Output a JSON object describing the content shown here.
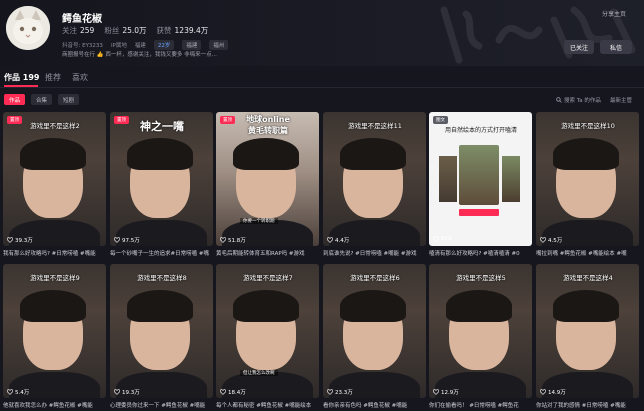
{
  "profile": {
    "name": "鳄鱼花椒",
    "stats": [
      {
        "label": "关注",
        "value": "259"
      },
      {
        "label": "粉丝",
        "value": "25.0万"
      },
      {
        "label": "获赞",
        "value": "1239.4万"
      }
    ],
    "id_label": "抖音号: EY3233",
    "tags": [
      "IP属地",
      "福建",
      "22岁",
      "福建",
      "福州"
    ],
    "bio": "商圈报号在行 👍 西一杯，感谢关注，我钱又要多 非嗨来一点...",
    "share": "分享主页",
    "follow_label": "已关注",
    "message_label": "私信"
  },
  "tabs": [
    {
      "label": "作品 199"
    },
    {
      "label": "推荐"
    },
    {
      "label": "喜欢"
    }
  ],
  "filters": [
    "作品",
    "合集",
    "短剧"
  ],
  "search_label": "搜索 Ta 的作品",
  "sort_label": "最新主管",
  "videos": [
    {
      "caption": "游戏里不是这样2",
      "likes": "39.3万",
      "title": "我有那么好攻略吗? #日常唠嗑 #嘴能",
      "badge": "置顶",
      "style": "dark",
      "cap_type": "small"
    },
    {
      "caption": "神之一嘴",
      "likes": "97.5万",
      "title": "每一个砂嘴子一生的追求#日常唠嗑 #嘴",
      "badge": "置顶",
      "style": "dark",
      "cap_type": "big"
    },
    {
      "caption": "地球online\n黄毛转职篇",
      "likes": "51.8万",
      "title": "黄毛后期能转体育五和RAP吗 #游戏",
      "badge": "置顶",
      "style": "bright",
      "cap_type": "mid",
      "subtitle": "你要一个转职期"
    },
    {
      "caption": "游戏里不是这样11",
      "likes": "4.4万",
      "title": "到底谁先说? #日常唠嗑 #嘴能 #游戏",
      "badge": "",
      "style": "dark",
      "cap_type": "small"
    },
    {
      "caption": "用自然绘本的方式打开嗑清",
      "likes": "829",
      "title": "嗑清有那么好攻略吗? #嗑清嗑清 #0",
      "badge": "图文",
      "style": "white",
      "cap_type": "dark"
    },
    {
      "caption": "游戏里不是这样10",
      "likes": "4.5万",
      "title": "嘴拉到嘴 #鳄鱼花椒 #嘴能绘本 #嘴",
      "badge": "",
      "style": "dark",
      "cap_type": "small"
    },
    {
      "caption": "游戏里不是这样9",
      "likes": "5.4万",
      "title": "他就喜欢我怎么办 #鳄鱼花椒 #嘴能",
      "badge": "",
      "style": "dark",
      "cap_type": "small"
    },
    {
      "caption": "游戏里不是这样8",
      "likes": "19.3万",
      "title": "心理委员你过来一下 #鳄鱼花椒 #嘴能",
      "badge": "",
      "style": "dark",
      "cap_type": "small"
    },
    {
      "caption": "游戏里不是这样7",
      "likes": "18.4万",
      "title": "每个人都有秘密 #鳄鱼花椒 #嘴能绘本",
      "badge": "",
      "style": "dark",
      "cap_type": "small",
      "subtitle": "但让我怎么改啊"
    },
    {
      "caption": "游戏里不是这样6",
      "likes": "23.3万",
      "title": "看你亲亲有色吗 #鳄鱼花椒 #嘴能",
      "badge": "",
      "style": "dark",
      "cap_type": "small"
    },
    {
      "caption": "游戏里不是这样5",
      "likes": "12.9万",
      "title": "你们在偷看吗！ #日常唠嗑 #鳄鱼花",
      "badge": "",
      "style": "dark",
      "cap_type": "small"
    },
    {
      "caption": "游戏里不是这样4",
      "likes": "14.9万",
      "title": "你站对了我的感情 #日常唠嗑 #嘴能",
      "badge": "",
      "style": "dark",
      "cap_type": "small"
    }
  ],
  "colors": {
    "accent": "#fe2c55",
    "background": "#16161f"
  }
}
